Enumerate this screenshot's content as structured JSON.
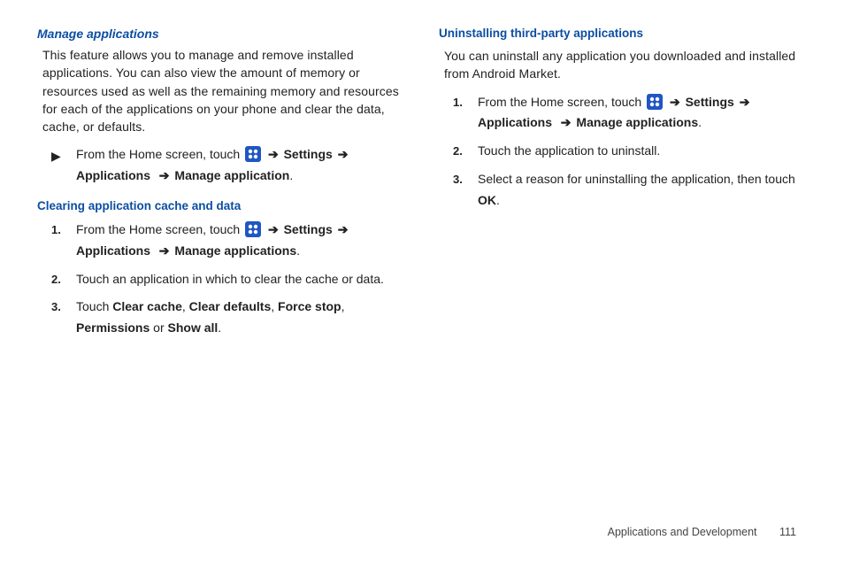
{
  "left": {
    "heading1": "Manage applications",
    "intro": "This feature allows you to manage and remove installed applications. You can also view the amount of memory or resources used as well as the remaining memory and resources for each of the applications on your phone and clear the data, cache, or defaults.",
    "bullet_pre": "From the Home screen, touch ",
    "nav": {
      "arrow": "➔",
      "settings": "Settings",
      "apps": "Applications",
      "manage1": "Manage application"
    },
    "heading2": "Clearing application cache and data",
    "steps": [
      {
        "num": "1.",
        "pre": "From the Home screen, touch ",
        "manage": "Manage applications"
      },
      {
        "num": "2.",
        "text": "Touch an application in which to clear the cache or data."
      },
      {
        "num": "3.",
        "pre": "Touch ",
        "cc": "Clear cache",
        "cd": "Clear defaults",
        "fs": "Force stop",
        "perm": "Permissions",
        "or": " or ",
        "sa": "Show all",
        "end": "."
      }
    ]
  },
  "right": {
    "heading1": "Uninstalling third-party applications",
    "intro": "You can uninstall any application you downloaded and installed from Android Market.",
    "steps": [
      {
        "num": "1.",
        "pre": "From the Home screen, touch ",
        "manage": "Manage applications"
      },
      {
        "num": "2.",
        "text": "Touch the application to uninstall."
      },
      {
        "num": "3.",
        "pre": "Select a reason for uninstalling the application, then touch ",
        "ok": "OK",
        "end": "."
      }
    ]
  },
  "footer": {
    "section": "Applications and Development",
    "page": "111"
  },
  "icons": {
    "apps": "apps-icon",
    "play": "▶"
  }
}
